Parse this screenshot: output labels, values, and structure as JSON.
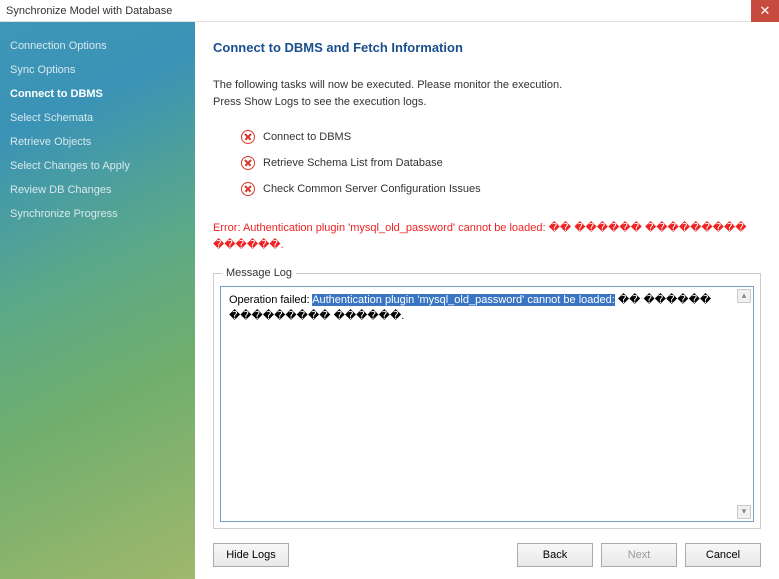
{
  "window": {
    "title": "Synchronize Model with Database"
  },
  "sidebar": {
    "items": [
      {
        "label": "Connection Options"
      },
      {
        "label": "Sync Options"
      },
      {
        "label": "Connect to DBMS"
      },
      {
        "label": "Select Schemata"
      },
      {
        "label": "Retrieve Objects"
      },
      {
        "label": "Select Changes to Apply"
      },
      {
        "label": "Review DB Changes"
      },
      {
        "label": "Synchronize Progress"
      }
    ],
    "active_index": 2
  },
  "main": {
    "title": "Connect to DBMS and Fetch Information",
    "intro_line1": "The following tasks will now be executed. Please monitor the execution.",
    "intro_line2": "Press Show Logs to see the execution logs.",
    "tasks": [
      {
        "label": "Connect to DBMS",
        "status": "error"
      },
      {
        "label": "Retrieve Schema List from Database",
        "status": "error"
      },
      {
        "label": "Check Common Server Configuration Issues",
        "status": "error"
      }
    ],
    "error": "Error: Authentication plugin 'mysql_old_password' cannot be loaded: �� ������ ��������� ������."
  },
  "log": {
    "legend": "Message Log",
    "prefix": "Operation failed: ",
    "selected": "Authentication plugin 'mysql_old_password' cannot be loaded:",
    "suffix": " �� ������ ��������� ������."
  },
  "buttons": {
    "hide_logs": "Hide Logs",
    "back": "Back",
    "next": "Next",
    "cancel": "Cancel"
  }
}
